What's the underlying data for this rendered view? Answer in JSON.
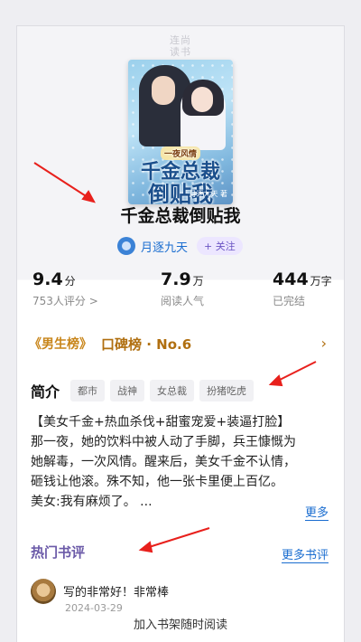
{
  "watermark": [
    "连尚",
    "读书"
  ],
  "cover": {
    "tag": "一夜风情",
    "line1": "千金总裁",
    "line2": "倒贴我",
    "author_small": "月逐九天 著"
  },
  "book": {
    "title": "千金总裁倒贴我",
    "author": "月逐九天",
    "follow_label": "+ 关注"
  },
  "stats": [
    {
      "value": "9.4",
      "unit": "分",
      "sub": "753人评分 >"
    },
    {
      "value": "7.9",
      "unit": "万",
      "sub": "阅读人气"
    },
    {
      "value": "444",
      "unit": "万字",
      "sub": "已完结"
    }
  ],
  "rank": {
    "badge": "男生榜",
    "text": "口碑榜 · No.6",
    "arrow": "›"
  },
  "intro": {
    "title": "简介",
    "tags": [
      "都市",
      "战神",
      "女总裁",
      "扮猪吃虎"
    ],
    "lines": [
      "【美女千金+热血杀伐+甜蜜宠爱+装逼打脸】",
      "那一夜，她的饮料中被人动了手脚，兵王慷慨为",
      "她解毒，一次风情。醒来后，美女千金不认情，",
      "砸钱让他滚。殊不知，他一张卡里便上百亿。",
      "美女:我有麻烦了。 ..."
    ],
    "more_label": "更多"
  },
  "reviews": {
    "title": "热门书评",
    "more_label": "更多书评",
    "items": [
      {
        "text": "写的非常好！非常棒",
        "date": "2024-03-29"
      }
    ]
  },
  "bottom": {
    "label": "加入书架随时阅读"
  },
  "colors": {
    "annotation_arrow": "#e8201c",
    "link": "#1a6dd0",
    "rank": "#b06f10",
    "section_purple": "#6b5aa8"
  }
}
